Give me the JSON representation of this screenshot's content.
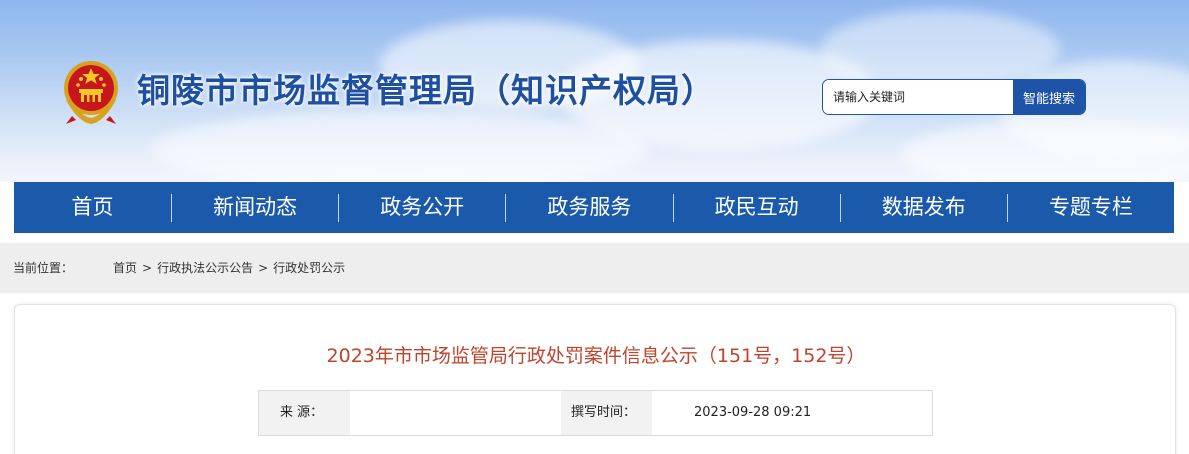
{
  "header": {
    "site_title": "铜陵市市场监督管理局（知识产权局）",
    "emblem_icon": "national-emblem-icon"
  },
  "search": {
    "placeholder": "请输入关键词",
    "button_label": "智能搜索"
  },
  "nav": {
    "items": [
      {
        "label": "首页"
      },
      {
        "label": "新闻动态"
      },
      {
        "label": "政务公开"
      },
      {
        "label": "政务服务"
      },
      {
        "label": "政民互动"
      },
      {
        "label": "数据发布"
      },
      {
        "label": "专题专栏"
      }
    ]
  },
  "breadcrumb": {
    "label": "当前位置：",
    "items": [
      "首页",
      "行政执法公示公告",
      "行政处罚公示"
    ],
    "separator": ">"
  },
  "article": {
    "title": "2023年市市场监管局行政处罚案件信息公示（151号，152号）",
    "source_label": "来 源：",
    "source_value": "",
    "date_label": "撰写时间：",
    "date_value": "2023-09-28 09:21"
  },
  "colors": {
    "nav_background": "#1b5aab",
    "title_text": "#1f4fa0",
    "article_title": "#c0432c",
    "breadcrumb_background": "#eeeeee"
  }
}
